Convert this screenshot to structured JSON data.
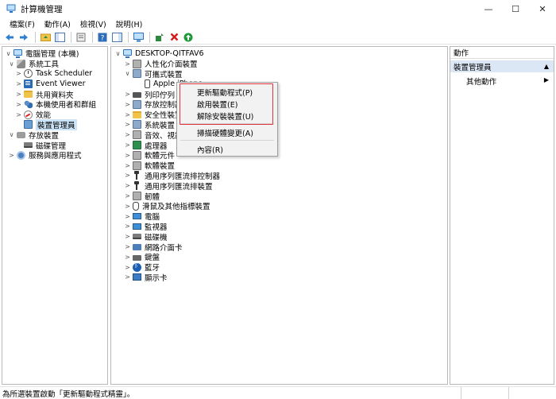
{
  "window": {
    "title": "計算機管理"
  },
  "window_buttons": {
    "minimize": "—",
    "maximize": "☐",
    "close": "✕"
  },
  "menu": [
    "檔案(F)",
    "動作(A)",
    "檢視(V)",
    "說明(H)"
  ],
  "left_tree": [
    {
      "label": "電腦管理 (本機)",
      "icon": "computer-icon",
      "expand": "∨"
    },
    {
      "label": "系統工具",
      "icon": "tools-icon",
      "expand": "∨"
    },
    {
      "label": "Task Scheduler",
      "icon": "clock-icon",
      "expand": ">"
    },
    {
      "label": "Event Viewer",
      "icon": "event-log-icon",
      "expand": ">"
    },
    {
      "label": "共用資料夾",
      "icon": "shared-folder-icon",
      "expand": ">"
    },
    {
      "label": "本機使用者和群組",
      "icon": "users-icon",
      "expand": ">"
    },
    {
      "label": "效能",
      "icon": "performance-icon",
      "expand": ">"
    },
    {
      "label": "裝置管理員",
      "icon": "device-manager-icon",
      "expand": "",
      "selected": true
    },
    {
      "label": "存放裝置",
      "icon": "storage-icon",
      "expand": "∨"
    },
    {
      "label": "磁碟管理",
      "icon": "disk-icon",
      "expand": ""
    },
    {
      "label": "服務與應用程式",
      "icon": "services-icon",
      "expand": ">"
    }
  ],
  "device_tree": {
    "root": "DESKTOP-QITFAV6",
    "items": [
      {
        "label": "人性化介面裝置",
        "icon": "hid-icon",
        "expand": ">"
      },
      {
        "label": "可攜式裝置",
        "icon": "portable-device-icon",
        "expand": "∨"
      },
      {
        "label": "Apple iPhone",
        "icon": "phone-icon",
        "expand": ""
      },
      {
        "label": "列印佇列",
        "icon": "printer-icon",
        "expand": ">"
      },
      {
        "label": "存放控制器",
        "icon": "storage-controller-icon",
        "expand": ">"
      },
      {
        "label": "安全性裝置",
        "icon": "security-icon",
        "expand": ">"
      },
      {
        "label": "系統裝置",
        "icon": "system-device-icon",
        "expand": ">"
      },
      {
        "label": "音效、視訊",
        "icon": "sound-icon",
        "expand": ">"
      },
      {
        "label": "處理器",
        "icon": "processor-icon",
        "expand": ">"
      },
      {
        "label": "軟體元件",
        "icon": "software-component-icon",
        "expand": ">"
      },
      {
        "label": "軟體裝置",
        "icon": "software-device-icon",
        "expand": ">"
      },
      {
        "label": "通用序列匯流排控制器",
        "icon": "usb-icon",
        "expand": ">"
      },
      {
        "label": "通用序列匯流排裝置",
        "icon": "usb-icon",
        "expand": ">"
      },
      {
        "label": "韌體",
        "icon": "firmware-icon",
        "expand": ">"
      },
      {
        "label": "滑鼠及其他指標裝置",
        "icon": "mouse-icon",
        "expand": ">"
      },
      {
        "label": "電腦",
        "icon": "computer-icon",
        "expand": ">"
      },
      {
        "label": "監視器",
        "icon": "monitor-icon",
        "expand": ">"
      },
      {
        "label": "磁碟機",
        "icon": "disk-drive-icon",
        "expand": ">"
      },
      {
        "label": "網路介面卡",
        "icon": "network-adapter-icon",
        "expand": ">"
      },
      {
        "label": "鍵盤",
        "icon": "keyboard-icon",
        "expand": ">"
      },
      {
        "label": "藍牙",
        "icon": "bluetooth-icon",
        "expand": ">"
      },
      {
        "label": "顯示卡",
        "icon": "display-adapter-icon",
        "expand": ">"
      }
    ]
  },
  "context_menu": {
    "items": [
      "更新驅動程式(P)",
      "啟用裝置(E)",
      "解除安裝裝置(U)",
      "掃描硬體變更(A)",
      "內容(R)"
    ]
  },
  "actions": {
    "header": "動作",
    "section": "裝置管理員",
    "section_arrow": "▲",
    "more": "其他動作",
    "more_arrow": "▶"
  },
  "status": "為所選裝置啟動「更新驅動程式精靈」。"
}
